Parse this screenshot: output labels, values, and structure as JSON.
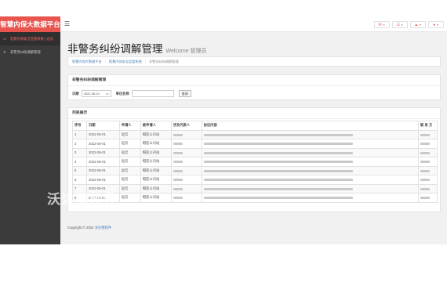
{
  "app": {
    "title": "智慧内保大数据平台",
    "accent": "#e8544e"
  },
  "topbar": {
    "menu_icon": "hamburger-icon",
    "buttons": [
      {
        "icon": "envelope-icon"
      },
      {
        "icon": "tasks-icon"
      },
      {
        "icon": "bell-icon"
      },
      {
        "icon": "user-icon"
      }
    ]
  },
  "sidebar": {
    "items": [
      {
        "label": "智慧内保安全监管系统 | 总览",
        "icon": "warning-icon",
        "active": true
      },
      {
        "label": "非警务纠纷调解管理",
        "icon": "list-icon",
        "active": false
      }
    ]
  },
  "page": {
    "title": "非警务纠纷调解管理",
    "subtitle": "Welcome 管理员"
  },
  "breadcrumb": {
    "items": [
      "智慧内保大数据平台",
      "智慧内保安全监管系统",
      "非警务纠纷调解管理"
    ]
  },
  "search": {
    "panel_title": "非警务纠纷调解管理",
    "date_label": "日期",
    "date_value": "2022-06-01",
    "unit_label": "单位名称",
    "unit_value": "",
    "button_label": "查询"
  },
  "list": {
    "panel_title": "列表展示",
    "columns": [
      "序号",
      "日期",
      "申请人",
      "被申请人",
      "涉及代表人",
      "协议内容",
      "联 系 方"
    ],
    "rows": [
      {
        "no": "1",
        "date": "2022-06-01",
        "applicant": "赵云",
        "respondent": "帽迎公司站"
      },
      {
        "no": "2",
        "date": "2022-06-01",
        "applicant": "赵云",
        "respondent": "帽迎公司站"
      },
      {
        "no": "3",
        "date": "2022-06-01",
        "applicant": "赵云",
        "respondent": "帽迎公司站"
      },
      {
        "no": "4",
        "date": "2022-06-01",
        "applicant": "赵云",
        "respondent": "帽迎公司站"
      },
      {
        "no": "5",
        "date": "2022-06-01",
        "applicant": "赵云",
        "respondent": "帽迎公司站"
      },
      {
        "no": "6",
        "date": "2022-06-01",
        "applicant": "赵云",
        "respondent": "帽迎公司站"
      },
      {
        "no": "7",
        "date": "2022-06-01",
        "applicant": "赵云",
        "respondent": "帽迎公司站"
      },
      {
        "no": "8",
        "date": "2022-06-01",
        "applicant": "赵云",
        "respondent": "帽迎公司站"
      }
    ]
  },
  "footer": {
    "copyright": "Copyright © 2022",
    "company": "沃达德软件"
  },
  "watermark": "沃达德软件"
}
